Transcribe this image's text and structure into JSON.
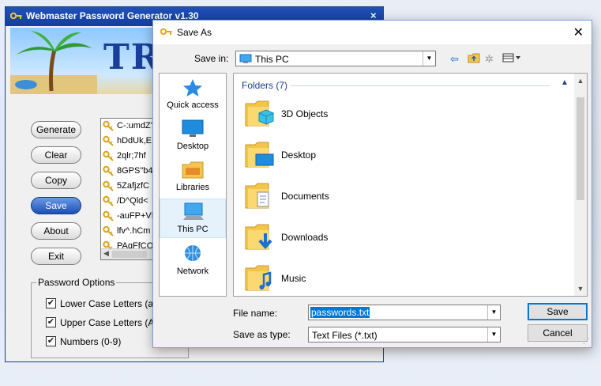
{
  "app": {
    "title": "Webmaster Password Generator v1.30",
    "banner_text": "TROPI",
    "buttons": [
      "Generate",
      "Clear",
      "Copy",
      "Save",
      "About",
      "Exit"
    ],
    "active_button": "Save",
    "passwords": [
      "C-:umdZ'",
      "hDdUk,E",
      "2qlr;7hf",
      "8GPS\"b4",
      "5ZafjzfC",
      "/D^Qld<",
      "-auFP+VE",
      "lfv^.hCm",
      "PAgFfCO"
    ],
    "options_title": "Password Options",
    "options": [
      {
        "label": "Lower Case Letters (a-z)",
        "checked": true
      },
      {
        "label": "Upper Case Letters (A-Z)",
        "checked": true
      },
      {
        "label": "Numbers (0-9)",
        "checked": true
      }
    ]
  },
  "dialog": {
    "title": "Save As",
    "save_in_label": "Save in:",
    "save_in_value": "This PC",
    "places": [
      {
        "label": "Quick access",
        "icon": "star-icon"
      },
      {
        "label": "Desktop",
        "icon": "desktop-icon"
      },
      {
        "label": "Libraries",
        "icon": "libraries-icon"
      },
      {
        "label": "This PC",
        "icon": "computer-icon",
        "selected": true
      },
      {
        "label": "Network",
        "icon": "network-icon"
      }
    ],
    "group_header": "Folders (7)",
    "folders": [
      {
        "label": "3D Objects",
        "icon": "3d-objects-folder-icon"
      },
      {
        "label": "Desktop",
        "icon": "desktop-folder-icon"
      },
      {
        "label": "Documents",
        "icon": "documents-folder-icon"
      },
      {
        "label": "Downloads",
        "icon": "downloads-folder-icon"
      },
      {
        "label": "Music",
        "icon": "music-folder-icon"
      }
    ],
    "file_name_label": "File name:",
    "file_name_value": "passwords.txt",
    "save_as_type_label": "Save as type:",
    "save_as_type_value": "Text Files (*.txt)",
    "save_button": "Save",
    "cancel_button": "Cancel"
  },
  "colors": {
    "accent": "#0078d7",
    "app_title_bar": "#1b46a8",
    "folder": "#f5c44b"
  }
}
